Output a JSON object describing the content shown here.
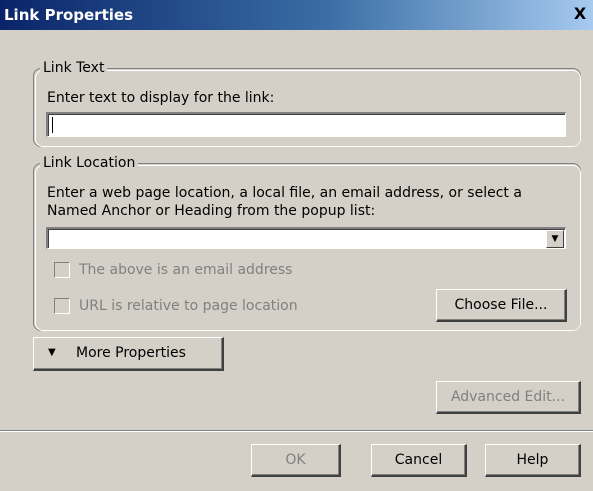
{
  "window": {
    "title": "Link Properties",
    "close_glyph": "X"
  },
  "link_text": {
    "legend": "Link Text",
    "prompt": "Enter text to display for the link:",
    "value": ""
  },
  "link_location": {
    "legend": "Link Location",
    "prompt_line1": "Enter a web page location, a local file, an email address, or select a",
    "prompt_line2": "Named Anchor or Heading from the popup list:",
    "value": "",
    "email_checkbox_label": "The above is an email address",
    "email_checked": false,
    "relative_checkbox_label": "URL is relative to page location",
    "relative_checked": false,
    "choose_file_label": "Choose File..."
  },
  "more_properties": {
    "label": "More Properties",
    "icon": "triangle-down-icon"
  },
  "advanced_edit_label": "Advanced Edit...",
  "footer": {
    "ok_label": "OK",
    "cancel_label": "Cancel",
    "help_label": "Help"
  },
  "colors": {
    "titlebar_start": "#0a246a",
    "titlebar_end": "#a6caf0",
    "face": "#d4d0c8",
    "disabled_text": "#808080"
  }
}
